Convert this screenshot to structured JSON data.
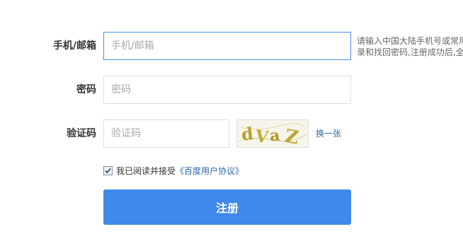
{
  "form": {
    "phone": {
      "label": "手机/邮箱",
      "placeholder": "手机/邮箱",
      "value": "",
      "hint": [
        "请输入中国大陆手机号或常用",
        "录和找回密码,注册成功后,全"
      ]
    },
    "password": {
      "label": "密码",
      "placeholder": "密码",
      "value": ""
    },
    "captcha": {
      "label": "验证码",
      "placeholder": "验证码",
      "value": "",
      "image_text": "dVaZ",
      "refresh_label": "换一张"
    },
    "agreement": {
      "checked": true,
      "text": "我已阅读并接受",
      "link_label": "《百度用户协议》"
    },
    "submit_label": "注册"
  },
  "colors": {
    "accent": "#3f89ec",
    "link": "#2e6aa8",
    "focus_border": "#4a90e2",
    "captcha_glyph": "#b8a12a"
  },
  "icons": {
    "checkbox": "check-icon"
  }
}
